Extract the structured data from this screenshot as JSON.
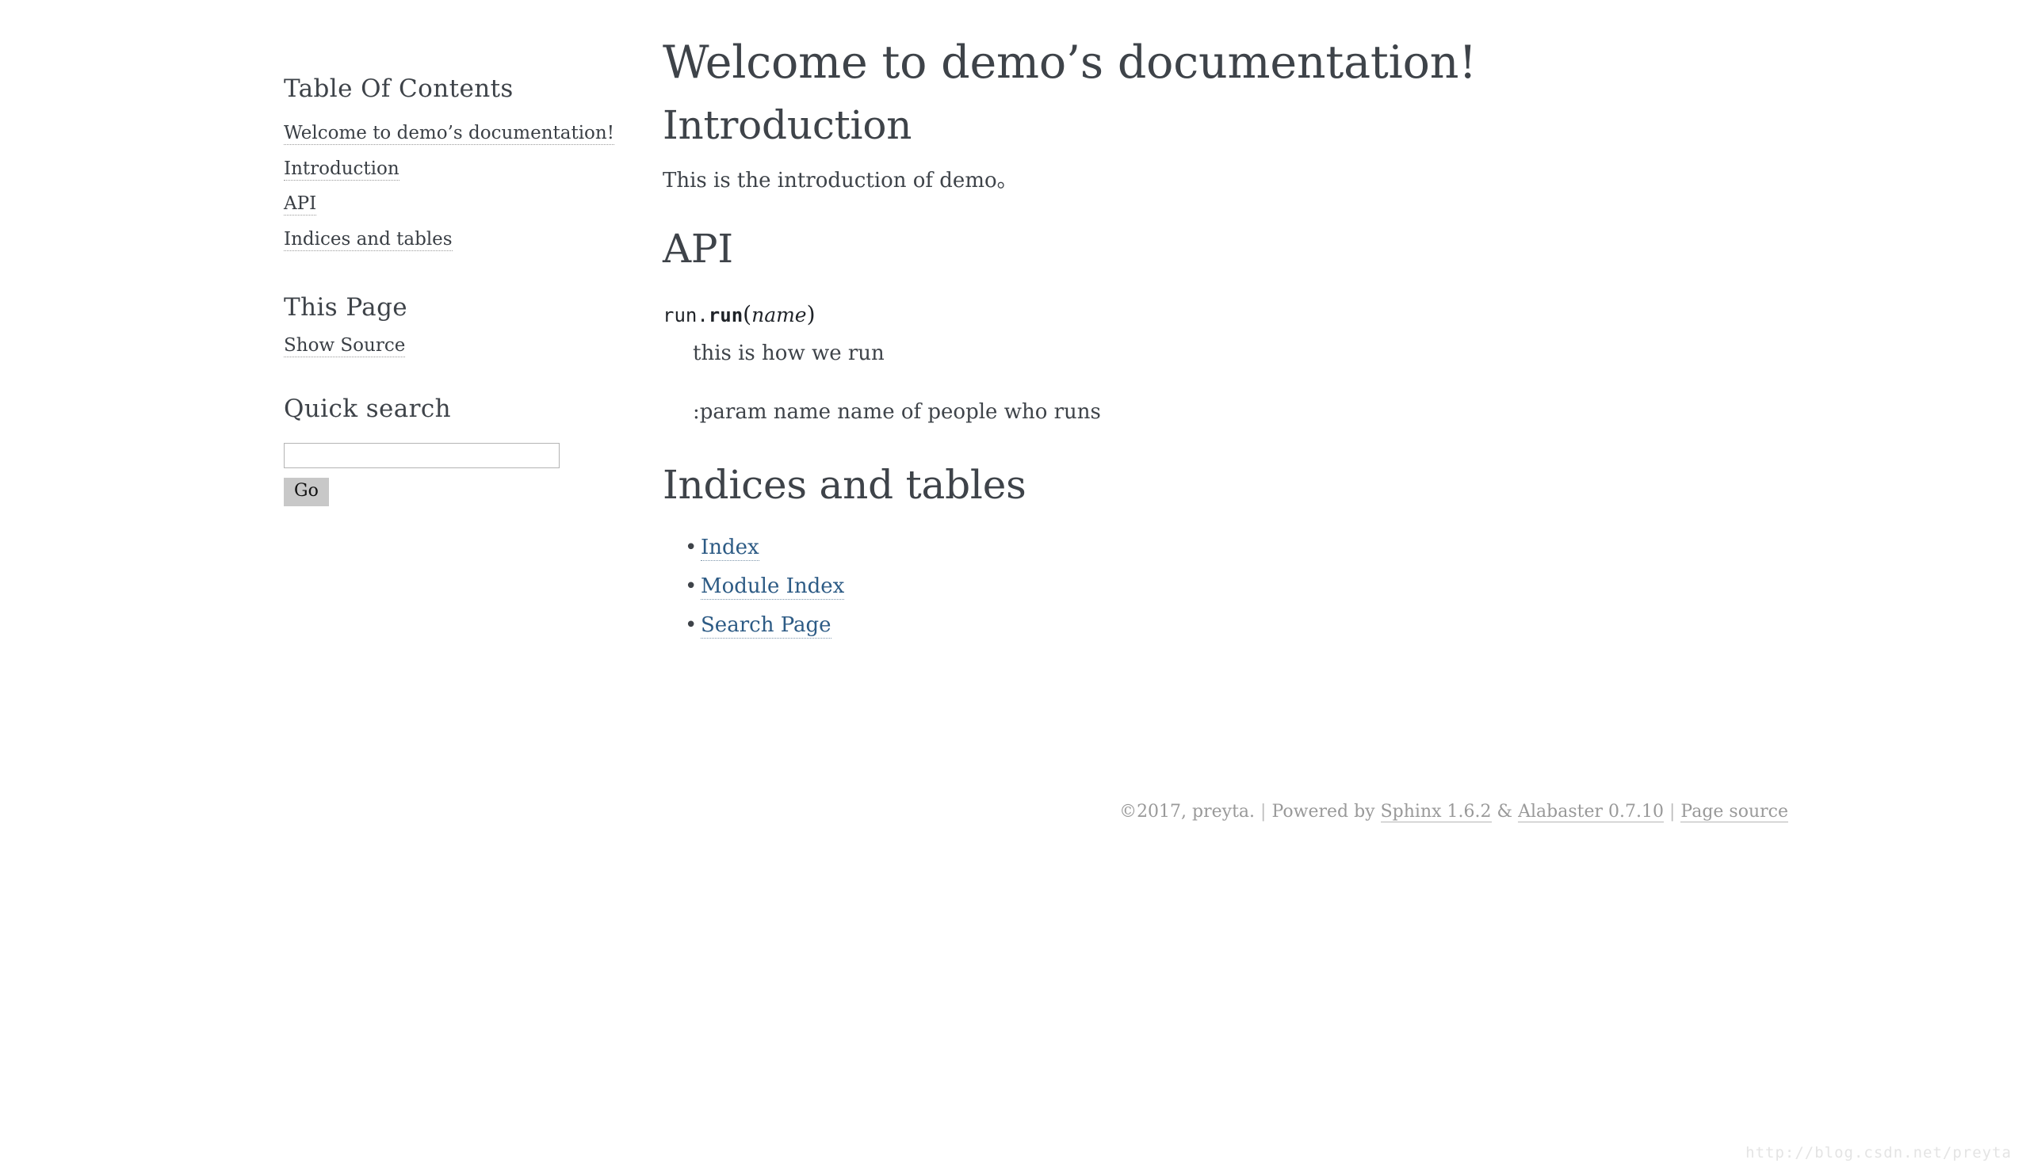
{
  "sidebar": {
    "toc_heading": "Table Of Contents",
    "toc_items": [
      {
        "label": "Welcome to demo’s documentation!"
      },
      {
        "label": "Introduction"
      },
      {
        "label": "API"
      },
      {
        "label": "Indices and tables"
      }
    ],
    "this_page_heading": "This Page",
    "show_source_label": "Show Source",
    "quick_search_heading": "Quick search",
    "search_value": "",
    "search_placeholder": "",
    "search_button_label": "Go"
  },
  "main": {
    "title": "Welcome to demo’s documentation!",
    "introduction": {
      "heading": "Introduction",
      "paragraph": "This is the introduction of demo。"
    },
    "api": {
      "heading": "API",
      "signature": {
        "prename": "run.",
        "name": "run",
        "open_paren": "(",
        "param": "name",
        "close_paren": ")"
      },
      "description": "this is how we run",
      "param_line": ":param name name of people who runs"
    },
    "indices": {
      "heading": "Indices and tables",
      "links": [
        {
          "label": "Index"
        },
        {
          "label": "Module Index"
        },
        {
          "label": "Search Page"
        }
      ]
    }
  },
  "footer": {
    "copyright": "©2017, preyta.",
    "sep1": "|",
    "powered_by": "Powered by",
    "sphinx_label": "Sphinx 1.6.2",
    "ampersand": "&",
    "alabaster_label": "Alabaster 0.7.10",
    "sep2": "|",
    "page_source_label": "Page source"
  },
  "watermark": {
    "text": "http://blog.csdn.net/preyta"
  },
  "colors": {
    "text": "#3E4349",
    "content_link": "#2d5b85",
    "sidebar_link": "#3a3f45",
    "footer_text": "#999999",
    "button_bg": "#c8c8c8",
    "input_border": "#b4b4b4",
    "watermark": "#e4e4e4"
  }
}
